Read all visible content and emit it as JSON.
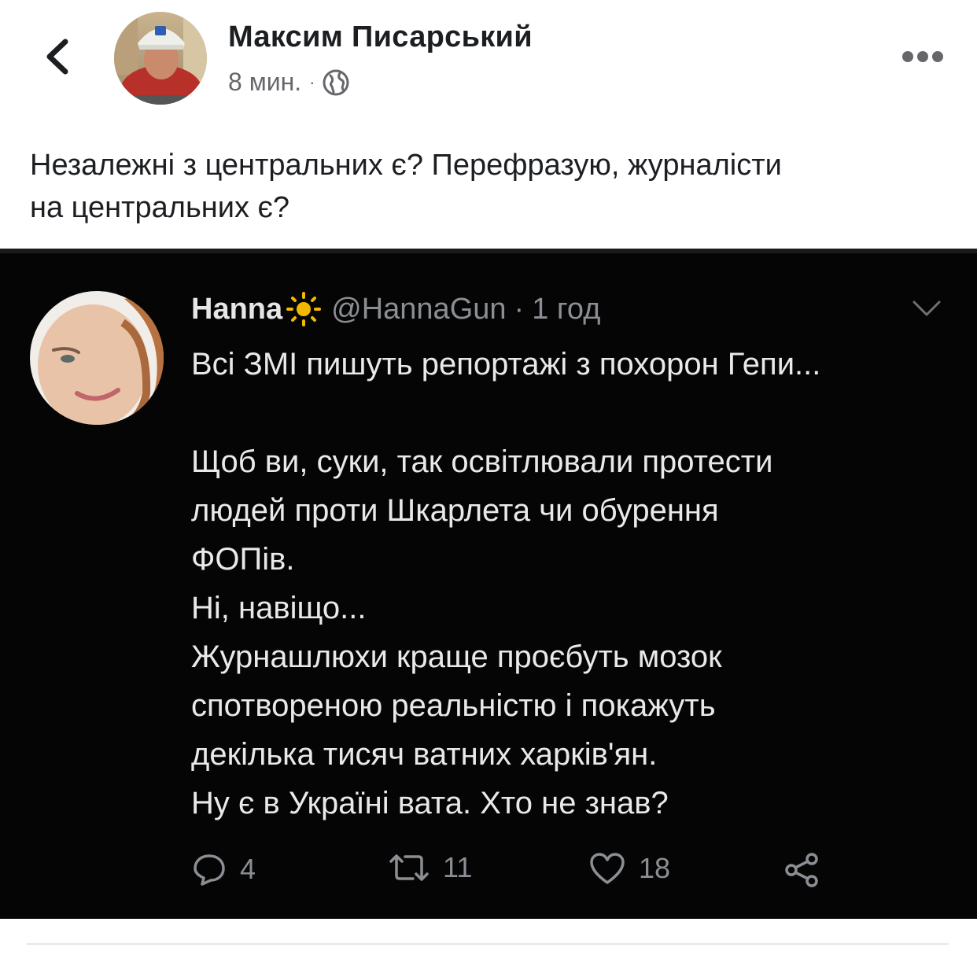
{
  "post": {
    "author": "Максим Писарський",
    "time": "8 мин.",
    "separator": "·",
    "text": "Незалежні з центральних є?  Перефразую,  журналісти\nна центральних є?"
  },
  "tweet": {
    "name": "Hanna",
    "handle": "@HannaGun",
    "time_sep": "·",
    "time": "1 год",
    "body": "Всі ЗМІ пишуть репортажі з похорон Гепи...\n\nЩоб ви, суки, так освітлювали протести\nлюдей проти Шкарлета чи обурення\nФОПів.\nНі, навіщо...\nЖурнашлюхи краще проєбуть мозок\nспотвореною реальністю і покажуть\nдекілька тисяч ватних харків'ян.\nНу є в Україні вата. Хто не знав?",
    "replies": "4",
    "retweets": "11",
    "likes": "18"
  },
  "icons": {
    "back": "chevron-left-icon",
    "more": "more-dots-icon",
    "privacy": "globe-icon",
    "tweet_menu": "chevron-down-icon",
    "reply": "reply-icon",
    "retweet": "retweet-icon",
    "like": "heart-icon",
    "share": "share-icon",
    "sun": "sun-icon"
  },
  "colors": {
    "text": "#1c1e21",
    "meta": "#65676b",
    "tweet_bg": "#050505",
    "tweet_text": "#e9e9e9",
    "tweet_muted": "#8b8f94",
    "sun": "#f5b800"
  }
}
